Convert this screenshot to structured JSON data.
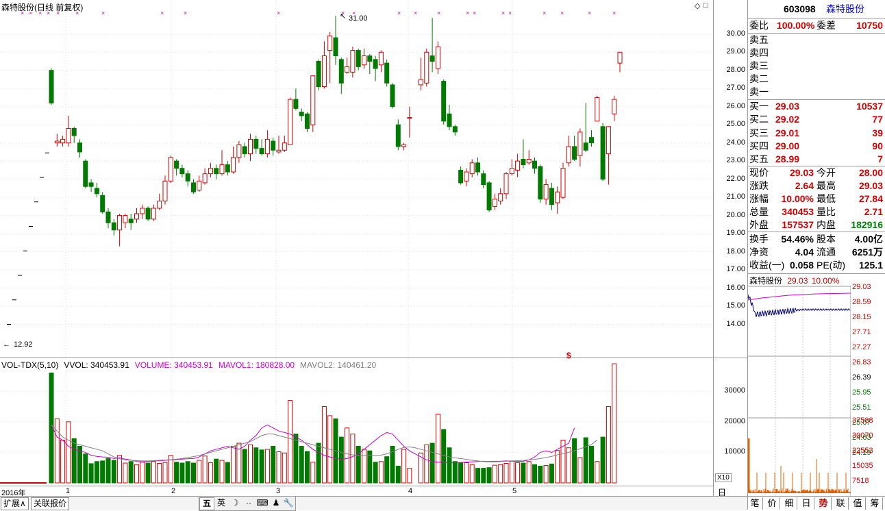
{
  "chart_header": {
    "title": "森特股份(日线 前复权)",
    "high_marker": "31.00",
    "low_marker": "12.92",
    "dollar_mark": "$",
    "corner_icon": "◇",
    "corner_box": "□"
  },
  "vol_header": {
    "name": "VOL-TDX(5,10)",
    "vvol": "VVOL: 340453.91",
    "volume": "VOLUME: 340453.91",
    "mavol1": "MAVOL1: 180828.00",
    "mavol2": "MAVOL2: 140461.20",
    "x10": "X10"
  },
  "colors": {
    "up": "#d40000",
    "down": "#007a00",
    "ma1": "#cc00cc",
    "ma2": "#808080",
    "mark": "#cc00cc"
  },
  "price_axis": [
    "30.00",
    "29.00",
    "28.00",
    "27.00",
    "26.00",
    "25.00",
    "24.00",
    "23.00",
    "22.00",
    "21.00",
    "20.00",
    "19.00",
    "18.00",
    "17.00",
    "16.00",
    "15.00",
    "14.00"
  ],
  "vol_axis": [
    "30000",
    "20000",
    "10000"
  ],
  "x_axis": [
    "2016年",
    "1",
    "2",
    "3",
    "4",
    "5"
  ],
  "period_label": "日线",
  "chart_data": {
    "type": "candlestick",
    "title": "森特股份(日线 前复权)",
    "ylim": [
      13.0,
      31.5
    ],
    "vol_ylim": [
      0,
      37000
    ],
    "candles": [
      [
        28.0,
        26.2,
        28.1,
        26.1
      ],
      [
        24.0,
        24.1,
        24.5,
        23.8
      ],
      [
        24.0,
        24.2,
        24.4,
        23.8
      ],
      [
        24.0,
        24.8,
        25.5,
        23.8
      ],
      [
        24.8,
        24.4,
        24.9,
        24.0
      ],
      [
        24.0,
        23.5,
        24.2,
        23.2
      ],
      [
        23.0,
        21.6,
        23.1,
        21.5
      ],
      [
        21.8,
        21.6,
        22.0,
        21.3
      ],
      [
        21.5,
        21.2,
        21.8,
        21.0
      ],
      [
        21.1,
        20.2,
        21.3,
        20.1
      ],
      [
        20.2,
        19.6,
        20.4,
        19.3
      ],
      [
        19.6,
        19.2,
        19.8,
        18.9
      ],
      [
        19.2,
        20.0,
        20.1,
        18.3
      ],
      [
        19.6,
        20.0,
        20.1,
        19.3
      ],
      [
        19.8,
        19.6,
        20.1,
        19.2
      ],
      [
        19.8,
        20.1,
        20.4,
        19.6
      ],
      [
        20.1,
        20.4,
        20.6,
        19.8
      ],
      [
        20.4,
        19.8,
        20.5,
        19.7
      ],
      [
        19.8,
        20.4,
        20.6,
        19.7
      ],
      [
        20.4,
        20.8,
        21.2,
        20.3
      ],
      [
        20.8,
        21.9,
        22.2,
        20.6
      ],
      [
        21.9,
        23.2,
        23.3,
        21.8
      ],
      [
        23.0,
        22.6,
        23.1,
        22.2
      ],
      [
        22.6,
        22.3,
        22.8,
        22.1
      ],
      [
        22.3,
        21.9,
        22.5,
        21.6
      ],
      [
        21.8,
        21.3,
        22.0,
        21.2
      ],
      [
        21.4,
        21.9,
        22.2,
        21.3
      ],
      [
        21.8,
        22.3,
        22.6,
        21.7
      ],
      [
        22.3,
        22.6,
        22.9,
        22.1
      ],
      [
        22.6,
        22.3,
        22.8,
        22.0
      ],
      [
        22.3,
        22.8,
        23.6,
        22.2
      ],
      [
        22.8,
        22.4,
        23.0,
        22.2
      ],
      [
        22.4,
        23.2,
        23.8,
        22.3
      ],
      [
        23.2,
        23.9,
        24.1,
        22.9
      ],
      [
        23.8,
        23.4,
        24.0,
        23.2
      ],
      [
        23.4,
        24.2,
        24.5,
        23.0
      ],
      [
        24.2,
        23.7,
        24.4,
        23.4
      ],
      [
        23.7,
        23.4,
        24.2,
        23.3
      ],
      [
        23.4,
        24.2,
        24.7,
        23.2
      ],
      [
        24.1,
        23.6,
        24.3,
        23.3
      ],
      [
        23.5,
        23.6,
        24.4,
        23.4
      ],
      [
        23.6,
        24.0,
        24.4,
        23.5
      ],
      [
        23.9,
        26.4,
        26.5,
        23.9
      ],
      [
        26.4,
        25.9,
        27.0,
        25.8
      ],
      [
        25.7,
        25.5,
        25.9,
        25.2
      ],
      [
        25.6,
        24.8,
        25.7,
        24.6
      ],
      [
        25.0,
        27.7,
        27.7,
        24.6
      ],
      [
        28.5,
        27.1,
        28.6,
        26.9
      ],
      [
        27.1,
        28.8,
        29.6,
        27.0
      ],
      [
        29.1,
        29.9,
        30.1,
        27.3
      ],
      [
        29.8,
        28.8,
        31.0,
        28.3
      ],
      [
        28.6,
        27.3,
        28.7,
        26.7
      ],
      [
        27.9,
        28.2,
        28.7,
        27.8
      ],
      [
        27.9,
        29.1,
        29.3,
        27.6
      ],
      [
        29.1,
        28.2,
        29.2,
        28.0
      ],
      [
        28.3,
        28.8,
        29.2,
        28.1
      ],
      [
        28.8,
        28.5,
        28.9,
        27.8
      ],
      [
        28.6,
        28.1,
        28.8,
        27.4
      ],
      [
        28.3,
        29.0,
        29.1,
        27.9
      ],
      [
        28.4,
        27.3,
        28.6,
        27.1
      ],
      [
        27.2,
        26.0,
        27.3,
        25.9
      ],
      [
        25.0,
        23.8,
        25.3,
        23.6
      ],
      [
        23.8,
        23.9,
        24.0,
        23.6
      ],
      [
        25.4,
        25.4,
        26.0,
        24.3
      ],
      [
        null,
        null,
        null,
        null
      ],
      [
        27.2,
        27.5,
        28.7,
        26.9
      ],
      [
        27.3,
        29.0,
        29.2,
        27.1
      ],
      [
        28.8,
        28.5,
        30.9,
        27.9
      ],
      [
        28.1,
        29.3,
        29.6,
        27.8
      ],
      [
        27.4,
        25.2,
        27.5,
        25.0
      ],
      [
        25.6,
        24.9,
        26.1,
        24.7
      ],
      [
        24.9,
        24.6,
        25.0,
        24.4
      ],
      [
        22.5,
        21.8,
        22.7,
        21.7
      ],
      [
        21.9,
        22.4,
        22.6,
        21.6
      ],
      [
        22.3,
        22.9,
        23.1,
        22.1
      ],
      [
        22.9,
        22.4,
        23.2,
        22.2
      ],
      [
        22.3,
        21.7,
        22.5,
        21.5
      ],
      [
        21.8,
        20.3,
        21.9,
        20.2
      ],
      [
        20.5,
        20.9,
        21.2,
        20.3
      ],
      [
        20.8,
        21.2,
        21.5,
        20.6
      ],
      [
        21.2,
        22.3,
        22.4,
        20.9
      ],
      [
        22.3,
        22.6,
        23.1,
        22.2
      ],
      [
        22.5,
        23.0,
        23.4,
        22.1
      ],
      [
        23.1,
        22.8,
        24.2,
        22.6
      ],
      [
        22.9,
        23.1,
        23.6,
        22.8
      ],
      [
        23.0,
        22.6,
        23.2,
        22.3
      ],
      [
        22.7,
        20.9,
        22.8,
        20.7
      ],
      [
        20.9,
        21.7,
        22.0,
        20.6
      ],
      [
        21.5,
        20.6,
        21.8,
        20.3
      ],
      [
        20.7,
        21.3,
        21.6,
        20.1
      ],
      [
        21.0,
        22.6,
        22.9,
        20.9
      ],
      [
        22.9,
        23.8,
        24.4,
        22.7
      ],
      [
        23.8,
        23.1,
        24.4,
        23.0
      ],
      [
        23.3,
        24.6,
        24.8,
        22.7
      ],
      [
        24.0,
        23.6,
        26.2,
        23.5
      ],
      [
        24.3,
        24.0,
        24.7,
        23.8
      ],
      [
        25.2,
        26.5,
        26.6,
        25.2
      ],
      [
        24.9,
        22.0,
        25.1,
        21.9
      ],
      [
        23.4,
        24.9,
        24.9,
        21.7
      ],
      [
        25.6,
        26.4,
        26.6,
        25.2
      ],
      [
        28.4,
        29.0,
        29.0,
        27.9
      ]
    ],
    "vol": [
      36000,
      21000,
      14000,
      20000,
      14500,
      12000,
      9500,
      6300,
      7000,
      7200,
      8000,
      7400,
      9000,
      6500,
      7000,
      6000,
      6800,
      6500,
      7000,
      6400,
      6700,
      9000,
      6800,
      6500,
      7000,
      6500,
      7400,
      8800,
      6600,
      7800,
      7400,
      6700,
      12000,
      13000,
      11000,
      12500,
      11500,
      10800,
      11000,
      12000,
      10200,
      9800,
      27000,
      16000,
      12000,
      10300,
      6800,
      13000,
      25000,
      22000,
      21000,
      15000,
      18000,
      16000,
      12000,
      11000,
      10500,
      6800,
      7000,
      8600,
      12000,
      5500,
      11000,
      4800,
      5600,
      9800,
      12500,
      13000,
      22500,
      17500,
      11500,
      7000,
      6600,
      6600,
      6000,
      4800,
      4800,
      5000,
      5800,
      6000,
      6400,
      7100,
      6600,
      6500,
      7000,
      6000,
      5500,
      5700,
      6200,
      10600,
      14000,
      11500,
      14500,
      8300,
      14800,
      12000,
      7000,
      15000,
      25000,
      39000
    ],
    "ma1": [
      19000,
      15000,
      14000,
      12000,
      11000,
      10500,
      10000,
      9000,
      8700,
      8500,
      8400,
      8000,
      8200,
      7800,
      7500,
      7000,
      6900,
      7000,
      7300,
      7200,
      7400,
      7500,
      7600,
      7800,
      7900,
      8000,
      8500,
      9500,
      10500,
      11000,
      11500,
      12000,
      11500,
      11000,
      12000,
      14000,
      15500,
      18000,
      19000,
      18000,
      17000,
      16500,
      16000,
      15000,
      14000,
      12500,
      11000,
      10000,
      9000,
      8500,
      8000,
      7800,
      8000,
      8600,
      9500,
      11000,
      12500,
      14000,
      15500,
      16500,
      16000,
      14000,
      12000,
      10500,
      9500,
      8500,
      7500,
      7000,
      6800,
      6700,
      6600,
      6600,
      6700,
      6800,
      6900,
      7000,
      7100,
      7000,
      7100,
      7100,
      7200,
      7200,
      7000,
      7100,
      7500,
      8500,
      10000,
      10500,
      10000,
      11000,
      12000,
      13000,
      18000
    ],
    "ma2": [
      19000,
      17000,
      15000,
      14000,
      13000,
      12500,
      12000,
      11500,
      11000,
      10500,
      9500,
      8500,
      7900,
      7500,
      7400,
      7300,
      7200,
      7200,
      7300,
      7400,
      7500,
      7600,
      7800,
      8000,
      8300,
      8600,
      9000,
      9500,
      10000,
      10500,
      11000,
      11500,
      12000,
      12500,
      13000,
      13500,
      14500,
      15500,
      16000,
      16000,
      15500,
      15000,
      14500,
      14000,
      13500,
      13000,
      12500,
      12000,
      11500,
      11000,
      10500,
      10000,
      9500,
      9200,
      9000,
      9000,
      9000,
      9000,
      9100,
      9500,
      10200,
      11000,
      11600,
      11800,
      11500,
      11000,
      10500,
      10000,
      9500,
      9000,
      8500,
      8200,
      8000,
      7700,
      7400,
      7200,
      7000,
      6900,
      6900,
      7000,
      7100,
      7200,
      7300,
      7400,
      7500,
      7700,
      8000,
      8300,
      8700,
      9200,
      9600,
      10000,
      10600,
      11200,
      11800,
      12600,
      14000
    ]
  },
  "top_markers": [
    "x",
    "x",
    "x",
    "x",
    "x",
    "x",
    "x",
    "x",
    "x",
    "x",
    "x",
    "x",
    "x",
    "x",
    "x",
    "x",
    "x",
    "x",
    "x",
    "x"
  ],
  "right_panel": {
    "code": "603098",
    "name": "森特股份",
    "weibi_label": "委比",
    "weibi_value": "100.00%",
    "weicha_label": "委差",
    "weicha_value": "10750",
    "sells": [
      {
        "label": "卖五",
        "price": "",
        "vol": ""
      },
      {
        "label": "卖四",
        "price": "",
        "vol": ""
      },
      {
        "label": "卖三",
        "price": "",
        "vol": ""
      },
      {
        "label": "卖二",
        "price": "",
        "vol": ""
      },
      {
        "label": "卖一",
        "price": "",
        "vol": ""
      }
    ],
    "buys": [
      {
        "label": "买一",
        "price": "29.03",
        "vol": "10537"
      },
      {
        "label": "买二",
        "price": "29.02",
        "vol": "77"
      },
      {
        "label": "买三",
        "price": "29.01",
        "vol": "39"
      },
      {
        "label": "买四",
        "price": "29.00",
        "vol": "90"
      },
      {
        "label": "买五",
        "price": "28.99",
        "vol": "7"
      }
    ],
    "stats": [
      {
        "k1": "现价",
        "v1": "29.03",
        "c1": "red",
        "k2": "今开",
        "v2": "28.00",
        "c2": "red"
      },
      {
        "k1": "涨跌",
        "v1": "2.64",
        "c1": "red",
        "k2": "最高",
        "v2": "29.03",
        "c2": "red"
      },
      {
        "k1": "涨幅",
        "v1": "10.00%",
        "c1": "red",
        "k2": "最低",
        "v2": "27.84",
        "c2": "red"
      },
      {
        "k1": "总量",
        "v1": "340453",
        "c1": "red",
        "k2": "量比",
        "v2": "2.71",
        "c2": "red"
      },
      {
        "k1": "外盘",
        "v1": "157537",
        "c1": "red",
        "k2": "内盘",
        "v2": "182916",
        "c2": "grn"
      }
    ],
    "stats2": [
      {
        "k1": "换手",
        "v1": "54.46%",
        "k2": "股本",
        "v2": "4.00亿"
      },
      {
        "k1": "净资",
        "v1": "4.04",
        "k2": "流通",
        "v2": "6251万"
      },
      {
        "k1": "收益(一)",
        "v1": "0.058",
        "k2": "PE(动)",
        "v2": "125.1"
      }
    ]
  },
  "mini_chart": {
    "name": "森特股份",
    "price": "29.03",
    "pct": "10.00%",
    "price_labels": [
      "29.03",
      "28.59",
      "28.15",
      "27.71",
      "27.27",
      "26.83",
      "26.39",
      "25.95",
      "25.51",
      "25.07",
      "24.63",
      "24.19"
    ],
    "vol_labels": [
      "37588",
      "30070",
      "22553",
      "15035",
      "7518"
    ]
  },
  "tabs": [
    "笔",
    "价",
    "细",
    "日",
    "势",
    "联",
    "值",
    "筹"
  ],
  "active_tab": "势",
  "bottom_buttons": [
    "扩展∧",
    "关联报价"
  ],
  "ime": [
    "五",
    "英",
    "☽",
    "··",
    "⌨",
    "♟",
    "🔧"
  ]
}
